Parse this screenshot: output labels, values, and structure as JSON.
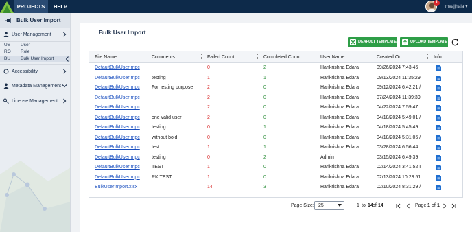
{
  "topnav": {
    "tabs": [
      "PROJECTS",
      "HELP"
    ],
    "notification_count": "1",
    "username": "mvajjhala"
  },
  "sidebar": {
    "title": "Bulk User Import",
    "groups": [
      {
        "label": "User Management"
      },
      {
        "label": "Accessibility"
      },
      {
        "label": "Metadata Management"
      },
      {
        "label": "License Management"
      }
    ],
    "subitems": [
      {
        "abbr": "US",
        "label": "User"
      },
      {
        "abbr": "RO",
        "label": "Role"
      },
      {
        "abbr": "BU",
        "label": "Bulk User Import"
      }
    ]
  },
  "main": {
    "title": "Bulk User Import",
    "default_template_label": "DEAFULT TEMPLATE",
    "upload_template_label": "UPLOAD TEMPLATE",
    "columns": [
      "File Name",
      "Comments",
      "Failed Count",
      "Completed Count",
      "User Name",
      "Created On",
      "Info"
    ],
    "rows": [
      {
        "file": "DefaultBulkUserImpc",
        "comment": "",
        "failed": "0",
        "completed": "2",
        "user": "Harikrishna Edara",
        "created": "09/26/2024 7:43:46"
      },
      {
        "file": "DefaultBulkUserImpc",
        "comment": "testing",
        "failed": "1",
        "completed": "1",
        "user": "Harikrishna Edara",
        "created": "09/13/2024 11:35:29"
      },
      {
        "file": "DefaultBulkUserImpc",
        "comment": "For testing purpose",
        "failed": "2",
        "completed": "0",
        "user": "Harikrishna Edara",
        "created": "09/12/2024 6:42:21 /"
      },
      {
        "file": "DefaultBulkUserImpc",
        "comment": "",
        "failed": "2",
        "completed": "0",
        "user": "Harikrishna Edara",
        "created": "07/24/2024 11:39:39"
      },
      {
        "file": "DefaultBulkUserImpc",
        "comment": "",
        "failed": "2",
        "completed": "0",
        "user": "Harikrishna Edara",
        "created": "04/22/2024 7:59:47"
      },
      {
        "file": "DefaultBulkUserImpc",
        "comment": "one valid user",
        "failed": "2",
        "completed": "0",
        "user": "Harikrishna Edara",
        "created": "04/18/2024 5:49:01 /"
      },
      {
        "file": "DefaultBulkUserImpc",
        "comment": "testing",
        "failed": "0",
        "completed": "1",
        "user": "Harikrishna Edara",
        "created": "04/18/2024 5:45:49"
      },
      {
        "file": "DefaultBulkUserImpc",
        "comment": "without bold",
        "failed": "0",
        "completed": "0",
        "user": "Harikrishna Edara",
        "created": "04/18/2024 5:31:05 /"
      },
      {
        "file": "DefaultBulkUserImpc",
        "comment": "test",
        "failed": "1",
        "completed": "1",
        "user": "Harikrishna Edara",
        "created": "03/28/2024 6:56:44"
      },
      {
        "file": "DefaultBulkUserImpc",
        "comment": "testing",
        "failed": "0",
        "completed": "2",
        "user": "Admin",
        "created": "03/15/2024 6:49:39"
      },
      {
        "file": "DefaultBulkUserImpc",
        "comment": "TEST",
        "failed": "1",
        "completed": "0",
        "user": "Harikrishna Edara",
        "created": "02/14/2024 3:41:52 I"
      },
      {
        "file": "DefaultBulkUserImpc",
        "comment": "RK TEST",
        "failed": "1",
        "completed": "0",
        "user": "Harikrishna Edara",
        "created": "02/13/2024 10:23:51"
      },
      {
        "file": "BulkUserImport.xlsx",
        "comment": "",
        "failed": "14",
        "completed": "3",
        "user": "Harikrishna Edara",
        "created": "02/10/2024 8:31:29 /"
      }
    ],
    "pager": {
      "page_size_label": "Page Size:",
      "page_size_value": "25",
      "range_from": "1",
      "range_to_label": "to",
      "range_to": "14",
      "of_label": "of",
      "total": "14",
      "page_label": "Page",
      "page_current": "1",
      "page_of_label": "of",
      "page_total": "1"
    }
  },
  "colors": {
    "topbar": "#0d2a4a",
    "accent_green": "#2e9e47",
    "failed_red": "#d92b2b",
    "completed_green": "#2d8f3b",
    "link_blue": "#1a4fbf"
  }
}
